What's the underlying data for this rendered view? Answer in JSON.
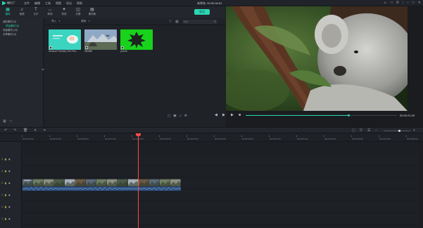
{
  "app": {
    "logo_text": "喵影工厂",
    "menu": [
      "文件",
      "编辑",
      "工具",
      "视图",
      "导出",
      "帮助"
    ],
    "window_title": "未命名: 00:00:30:02"
  },
  "media_toolbar": {
    "items": [
      {
        "label": "媒体",
        "icon": "folder-icon"
      },
      {
        "label": "音频",
        "icon": "music-icon"
      },
      {
        "label": "文字",
        "icon": "text-icon"
      },
      {
        "label": "转场",
        "icon": "transition-icon"
      },
      {
        "label": "特效",
        "icon": "effects-icon"
      },
      {
        "label": "分屏",
        "icon": "split-screen-icon"
      },
      {
        "label": "素材库",
        "icon": "stock-icon"
      }
    ],
    "export_label": "导出"
  },
  "library": {
    "items": [
      {
        "label": "我的素材 (3)",
        "selected": false
      },
      {
        "label": "项目素材 (3)",
        "selected": true
      },
      {
        "label": "背景素材 (15)",
        "selected": false
      },
      {
        "label": "共享素材 (0)",
        "selected": false
      }
    ]
  },
  "media_browser": {
    "import_label": "导入",
    "record_label": "录制",
    "search_placeholder": "搜索",
    "clips": [
      {
        "name": "Musical Fantasy Set Film...",
        "color": "#3bd4c0"
      },
      {
        "name": "Wildlife",
        "color": "#7b93b0"
      },
      {
        "name": "puzzle",
        "color": "#18d31c"
      }
    ]
  },
  "preview": {
    "timecode": "00:00:21:29",
    "progress": 0.68
  },
  "timeline": {
    "ruler": [
      "00:00:00:00",
      "00:00:04:05",
      "00:00:08:10",
      "00:00:12:15",
      "00:00:16:20",
      "00:00:20:25",
      "00:00:25:00",
      "00:00:29:05",
      "00:00:33:10",
      "00:00:37:15",
      "00:00:41:20",
      "00:00:45:25",
      "00:00:50:00",
      "00:00:54:05",
      "00:00:58:10"
    ],
    "tracks": [
      {
        "label": "4"
      },
      {
        "label": "3"
      },
      {
        "label": "2"
      },
      {
        "label": "1"
      },
      {
        "label": "1"
      },
      {
        "label": "1"
      }
    ],
    "clip_label": "Wildlife",
    "zoom": 0.6
  },
  "colors": {
    "accent": "#2bd7b4",
    "playhead": "#ff4a4a",
    "clip": "#2d4f80"
  }
}
